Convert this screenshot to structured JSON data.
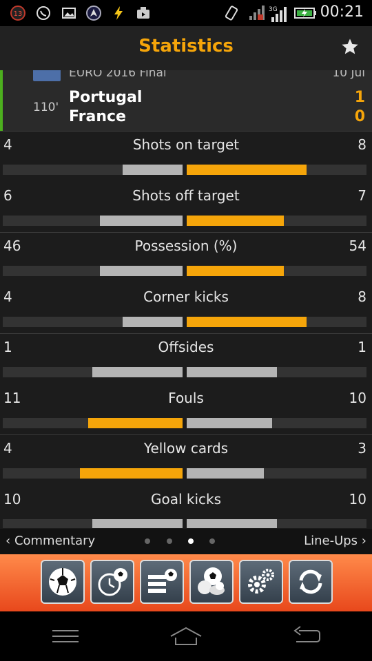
{
  "status_bar": {
    "notification_count": "13",
    "network": "3G",
    "time": "00:21"
  },
  "header": {
    "title": "Statistics"
  },
  "match": {
    "competition": "EURO 2016 Final",
    "date": "10 Jul",
    "minute": "110'",
    "home_team": "Portugal",
    "away_team": "France",
    "home_score": "1",
    "away_score": "0"
  },
  "stats": [
    {
      "name": "Shots on target",
      "home": "4",
      "away": "8",
      "leader": "away"
    },
    {
      "name": "Shots off target",
      "home": "6",
      "away": "7",
      "leader": "away"
    },
    {
      "name": "Possession (%)",
      "home": "46",
      "away": "54",
      "leader": "away"
    },
    {
      "name": "Corner kicks",
      "home": "4",
      "away": "8",
      "leader": "away"
    },
    {
      "name": "Offsides",
      "home": "1",
      "away": "1",
      "leader": "none"
    },
    {
      "name": "Fouls",
      "home": "11",
      "away": "10",
      "leader": "home"
    },
    {
      "name": "Yellow cards",
      "home": "4",
      "away": "3",
      "leader": "home"
    },
    {
      "name": "Goal kicks",
      "home": "10",
      "away": "10",
      "leader": "none"
    }
  ],
  "pager": {
    "prev_label": "Commentary",
    "next_label": "Line-Ups",
    "pages": 4,
    "active_page": 3
  },
  "toolbar": {
    "buttons": [
      "live-scores-icon",
      "fixtures-clock-icon",
      "standings-icon",
      "sports-icon",
      "settings-icon",
      "refresh-icon"
    ]
  },
  "colors": {
    "accent": "#f5a50a",
    "bar_neutral": "#b4b4b4",
    "bar_track": "#333333",
    "live_indicator": "#4caf1e"
  }
}
